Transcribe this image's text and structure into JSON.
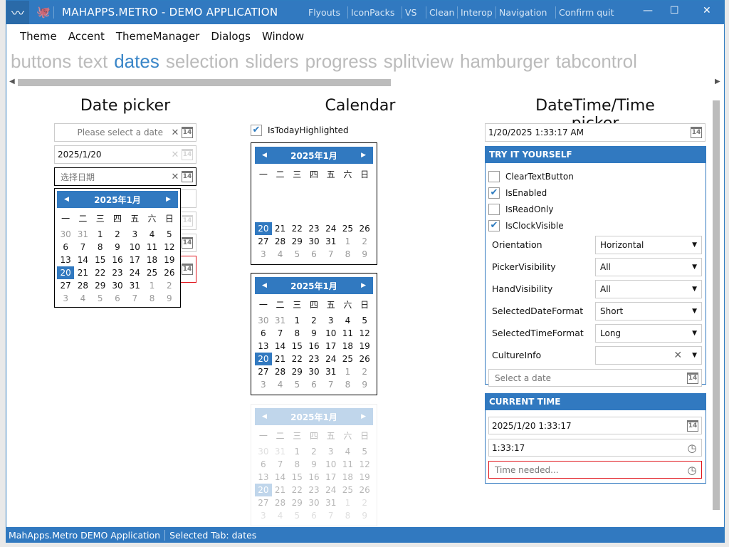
{
  "window": {
    "title": "MAHAPPS.METRO - DEMO APPLICATION",
    "commands": [
      "Flyouts",
      "IconPacks",
      "VS",
      "Clean",
      "Interop",
      "Navigation",
      "Confirm quit"
    ],
    "buttons": {
      "minimize": "—",
      "maximize": "☐",
      "close": "✕"
    }
  },
  "menu": [
    "Theme",
    "Accent",
    "ThemeManager",
    "Dialogs",
    "Window"
  ],
  "tabs": [
    {
      "label": "buttons"
    },
    {
      "label": "text"
    },
    {
      "label": "dates",
      "active": true
    },
    {
      "label": "selection"
    },
    {
      "label": "sliders"
    },
    {
      "label": "progress"
    },
    {
      "label": "splitview"
    },
    {
      "label": "hamburger"
    },
    {
      "label": "tabcontrol"
    }
  ],
  "datepicker": {
    "header": "Date picker",
    "inputs": [
      {
        "value": "",
        "placeholder": "Please select a date"
      },
      {
        "value": "2025/1/20",
        "placeholder": ""
      },
      {
        "value": "",
        "placeholder": "选择日期"
      }
    ],
    "popup_month": "2025年1月"
  },
  "calendar": {
    "header": "Calendar",
    "checkbox_label": "IsTodayHighlighted",
    "checked": true,
    "month": "2025年1月"
  },
  "weekdays": [
    "一",
    "二",
    "三",
    "四",
    "五",
    "六",
    "日"
  ],
  "weeks": [
    [
      30,
      31,
      1,
      2,
      3,
      4,
      5
    ],
    [
      6,
      7,
      8,
      9,
      10,
      11,
      12
    ],
    [
      13,
      14,
      15,
      16,
      17,
      18,
      19
    ],
    [
      20,
      21,
      22,
      23,
      24,
      25,
      26
    ],
    [
      27,
      28,
      29,
      30,
      31,
      1,
      2
    ],
    [
      3,
      4,
      5,
      6,
      7,
      8,
      9
    ]
  ],
  "selected_day": 20,
  "datetime": {
    "header": "DateTime/Time picker",
    "value": "1/20/2025 1:33:17 AM",
    "try": {
      "title": "TRY IT YOURSELF",
      "checks": [
        {
          "label": "ClearTextButton",
          "checked": false
        },
        {
          "label": "IsEnabled",
          "checked": true
        },
        {
          "label": "IsReadOnly",
          "checked": false
        },
        {
          "label": "IsClockVisible",
          "checked": true
        }
      ],
      "props": [
        {
          "label": "Orientation",
          "value": "Horizontal"
        },
        {
          "label": "PickerVisibility",
          "value": "All"
        },
        {
          "label": "HandVisibility",
          "value": "All"
        },
        {
          "label": "SelectedDateFormat",
          "value": "Short"
        },
        {
          "label": "SelectedTimeFormat",
          "value": "Long"
        },
        {
          "label": "CultureInfo",
          "value": ""
        }
      ],
      "date_placeholder": "Select a date"
    },
    "current": {
      "title": "CURRENT TIME",
      "date": "2025/1/20 1:33:17",
      "time": "1:33:17",
      "time_placeholder": "Time needed..."
    }
  },
  "status": {
    "app": "MahApps.Metro DEMO Application",
    "tab": "Selected Tab:  dates"
  },
  "colors": {
    "accent": "#3179c0",
    "error": "#e0161d"
  }
}
